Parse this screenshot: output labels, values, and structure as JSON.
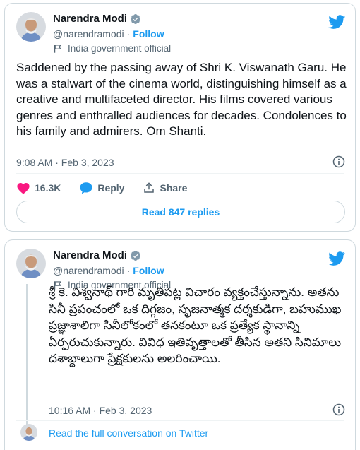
{
  "tweet1": {
    "name": "Narendra Modi",
    "handle": "@narendramodi",
    "separator": "·",
    "follow_label": "Follow",
    "label": "India government official",
    "text": "Saddened by the passing away of Shri K. Viswanath Garu. He was a stalwart of the cinema world, distinguishing himself as a creative and multifaceted director. His films covered various genres and enthralled audiences for decades. Condolences to his family and admirers. Om Shanti.",
    "timestamp": "9:08 AM · Feb 3, 2023",
    "likes": "16.3K",
    "reply_label": "Reply",
    "share_label": "Share",
    "read_replies_label": "Read 847 replies"
  },
  "tweet2": {
    "name": "Narendra Modi",
    "handle": "@narendramodi",
    "separator": "·",
    "follow_label": "Follow",
    "label": "India government official",
    "text": "శ్రీ కె. విశ్వనాథ్ గారి మృతిపట్ల విచారం వ్యక్తంచేస్తున్నాను. అతను సినీ ప్రపంచంలో ఒక దిగ్గజం, సృజనాత్మక దర్శకుడిగా, బహుముఖ ప్రజ్ఞాశాలిగా సినీలోకంలో తనకంటూ ఒక ప్రత్యేక స్థానాన్ని ఏర్పరుచుకున్నారు. వివిధ ఇతివృత్తాలతో తీసిన అతని సినిమాలు దశాబ్దాలుగా ప్రేక్షకులను అలరించాయి.",
    "timestamp": "10:16 AM · Feb 3, 2023",
    "read_full_label": "Read the full conversation on Twitter"
  },
  "colors": {
    "accent": "#1d9bf0",
    "like": "#f91880",
    "secondary_text": "#536471",
    "border": "#cfd9de"
  },
  "icons": {
    "verified": "verified-badge-icon",
    "flag": "flag-icon",
    "brand": "twitter-bird-icon",
    "info": "info-icon",
    "like": "heart-icon",
    "reply": "speech-bubble-icon",
    "share": "share-icon"
  }
}
